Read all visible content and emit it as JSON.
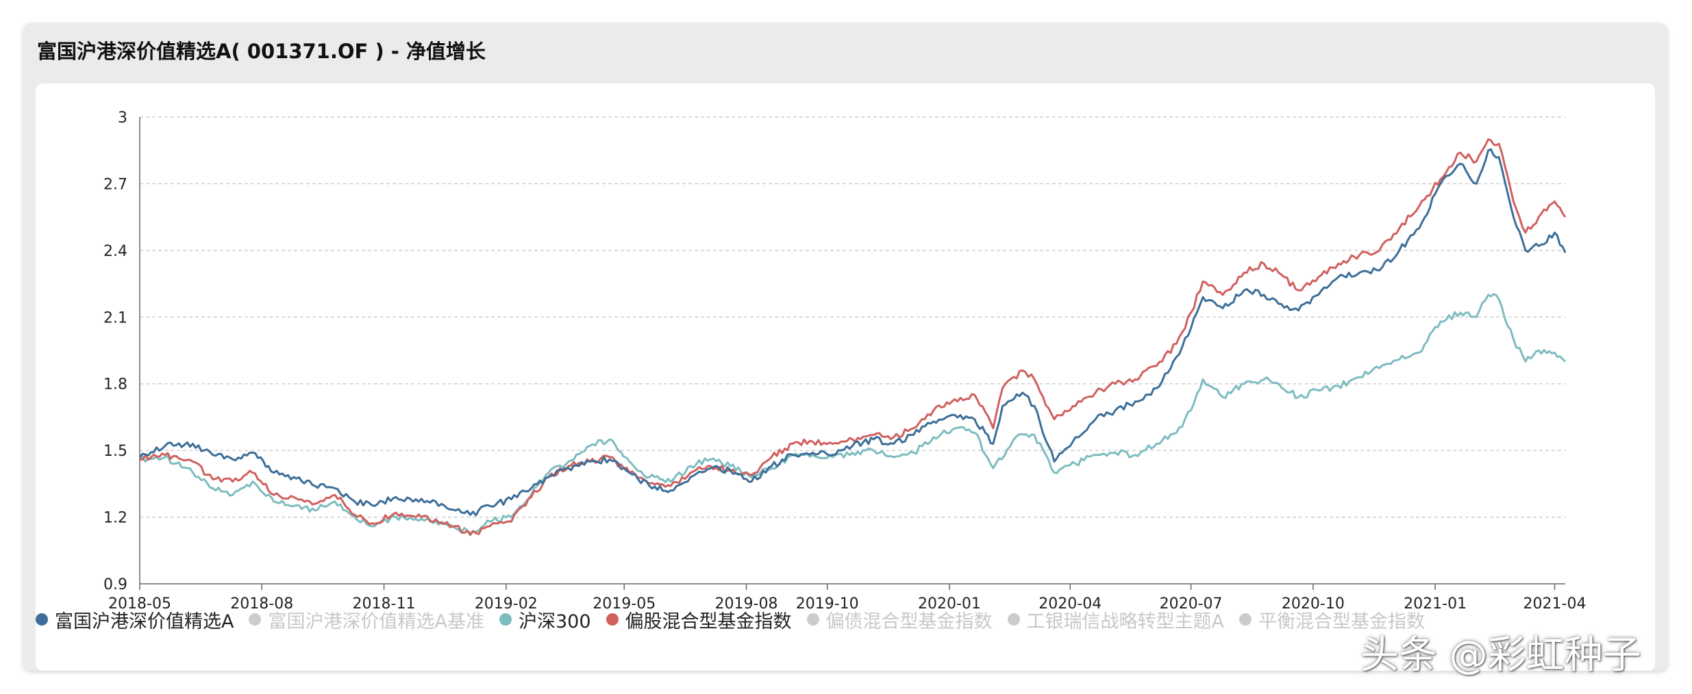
{
  "window": {
    "title": "富国沪港深价值精选A( 001371.OF ) - 净值增长"
  },
  "chart_data": {
    "type": "line",
    "title": "",
    "xlabel": "",
    "ylabel": "",
    "ylim": [
      0.9,
      3.0
    ],
    "yticks": [
      0.9,
      1.2,
      1.5,
      1.8,
      2.1,
      2.4,
      2.7,
      3
    ],
    "yticklabels": [
      "0.9",
      "1.2",
      "1.5",
      "1.8",
      "2.1",
      "2.4",
      "2.7",
      "3"
    ],
    "xlim": [
      "2018-05-01",
      "2021-04-09"
    ],
    "xticks": [
      "2018-05-01",
      "2018-08-01",
      "2018-11-01",
      "2019-02-01",
      "2019-05-01",
      "2019-08-01",
      "2019-10-01",
      "2020-01-01",
      "2020-04-01",
      "2020-07-01",
      "2020-10-01",
      "2021-01-01",
      "2021-04-01"
    ],
    "xticklabels": [
      "2018-05",
      "2018-08",
      "2018-11",
      "2019-02",
      "2019-05",
      "2019-08",
      "2019-10",
      "2020-01",
      "2020-04",
      "2020-07",
      "2020-10",
      "2021-01",
      "2021-04"
    ],
    "grid": true,
    "legend_position": "bottom",
    "series": [
      {
        "name": "沪深300",
        "color": "#7dbcbf",
        "visible": true,
        "points": [
          [
            "2018-05-01",
            1.46
          ],
          [
            "2018-05-20",
            1.47
          ],
          [
            "2018-06-10",
            1.4
          ],
          [
            "2018-06-25",
            1.33
          ],
          [
            "2018-07-10",
            1.3
          ],
          [
            "2018-07-25",
            1.36
          ],
          [
            "2018-08-10",
            1.27
          ],
          [
            "2018-08-25",
            1.25
          ],
          [
            "2018-09-10",
            1.23
          ],
          [
            "2018-09-25",
            1.27
          ],
          [
            "2018-10-10",
            1.2
          ],
          [
            "2018-10-25",
            1.16
          ],
          [
            "2018-11-10",
            1.2
          ],
          [
            "2018-11-25",
            1.19
          ],
          [
            "2018-12-10",
            1.18
          ],
          [
            "2018-12-25",
            1.15
          ],
          [
            "2019-01-05",
            1.13
          ],
          [
            "2019-01-20",
            1.18
          ],
          [
            "2019-02-05",
            1.2
          ],
          [
            "2019-02-20",
            1.3
          ],
          [
            "2019-03-05",
            1.4
          ],
          [
            "2019-03-20",
            1.45
          ],
          [
            "2019-04-05",
            1.52
          ],
          [
            "2019-04-20",
            1.55
          ],
          [
            "2019-05-05",
            1.45
          ],
          [
            "2019-05-20",
            1.38
          ],
          [
            "2019-06-05",
            1.36
          ],
          [
            "2019-06-20",
            1.43
          ],
          [
            "2019-07-05",
            1.46
          ],
          [
            "2019-07-20",
            1.43
          ],
          [
            "2019-08-05",
            1.38
          ],
          [
            "2019-08-20",
            1.42
          ],
          [
            "2019-09-05",
            1.48
          ],
          [
            "2019-09-20",
            1.48
          ],
          [
            "2019-10-05",
            1.47
          ],
          [
            "2019-10-20",
            1.49
          ],
          [
            "2019-11-05",
            1.5
          ],
          [
            "2019-11-20",
            1.47
          ],
          [
            "2019-12-05",
            1.49
          ],
          [
            "2019-12-20",
            1.56
          ],
          [
            "2020-01-05",
            1.6
          ],
          [
            "2020-01-20",
            1.58
          ],
          [
            "2020-02-03",
            1.42
          ],
          [
            "2020-02-20",
            1.56
          ],
          [
            "2020-03-05",
            1.57
          ],
          [
            "2020-03-20",
            1.4
          ],
          [
            "2020-04-05",
            1.44
          ],
          [
            "2020-04-20",
            1.48
          ],
          [
            "2020-05-05",
            1.49
          ],
          [
            "2020-05-20",
            1.48
          ],
          [
            "2020-06-05",
            1.53
          ],
          [
            "2020-06-20",
            1.58
          ],
          [
            "2020-07-01",
            1.68
          ],
          [
            "2020-07-10",
            1.82
          ],
          [
            "2020-07-25",
            1.74
          ],
          [
            "2020-08-10",
            1.8
          ],
          [
            "2020-08-25",
            1.82
          ],
          [
            "2020-09-05",
            1.8
          ],
          [
            "2020-09-20",
            1.74
          ],
          [
            "2020-10-05",
            1.77
          ],
          [
            "2020-10-20",
            1.79
          ],
          [
            "2020-11-05",
            1.83
          ],
          [
            "2020-11-20",
            1.87
          ],
          [
            "2020-12-05",
            1.91
          ],
          [
            "2020-12-20",
            1.94
          ],
          [
            "2021-01-05",
            2.08
          ],
          [
            "2021-01-20",
            2.12
          ],
          [
            "2021-02-01",
            2.1
          ],
          [
            "2021-02-10",
            2.2
          ],
          [
            "2021-02-18",
            2.18
          ],
          [
            "2021-03-01",
            2.0
          ],
          [
            "2021-03-10",
            1.9
          ],
          [
            "2021-03-20",
            1.95
          ],
          [
            "2021-04-01",
            1.94
          ],
          [
            "2021-04-09",
            1.9
          ]
        ]
      },
      {
        "name": "偏股混合型基金指数",
        "color": "#d0605e",
        "visible": true,
        "points": [
          [
            "2018-05-01",
            1.46
          ],
          [
            "2018-05-20",
            1.48
          ],
          [
            "2018-06-10",
            1.45
          ],
          [
            "2018-06-25",
            1.37
          ],
          [
            "2018-07-10",
            1.36
          ],
          [
            "2018-07-25",
            1.4
          ],
          [
            "2018-08-10",
            1.3
          ],
          [
            "2018-08-25",
            1.29
          ],
          [
            "2018-09-10",
            1.26
          ],
          [
            "2018-09-25",
            1.3
          ],
          [
            "2018-10-10",
            1.21
          ],
          [
            "2018-10-25",
            1.17
          ],
          [
            "2018-11-10",
            1.22
          ],
          [
            "2018-11-25",
            1.2
          ],
          [
            "2018-12-10",
            1.19
          ],
          [
            "2018-12-25",
            1.16
          ],
          [
            "2019-01-05",
            1.12
          ],
          [
            "2019-01-20",
            1.16
          ],
          [
            "2019-02-05",
            1.18
          ],
          [
            "2019-02-20",
            1.29
          ],
          [
            "2019-03-05",
            1.38
          ],
          [
            "2019-03-20",
            1.43
          ],
          [
            "2019-04-05",
            1.45
          ],
          [
            "2019-04-20",
            1.47
          ],
          [
            "2019-05-05",
            1.4
          ],
          [
            "2019-05-20",
            1.35
          ],
          [
            "2019-06-05",
            1.34
          ],
          [
            "2019-06-20",
            1.4
          ],
          [
            "2019-07-05",
            1.43
          ],
          [
            "2019-07-20",
            1.41
          ],
          [
            "2019-08-05",
            1.39
          ],
          [
            "2019-08-20",
            1.47
          ],
          [
            "2019-09-05",
            1.53
          ],
          [
            "2019-09-20",
            1.54
          ],
          [
            "2019-10-05",
            1.53
          ],
          [
            "2019-10-20",
            1.55
          ],
          [
            "2019-11-05",
            1.57
          ],
          [
            "2019-11-20",
            1.56
          ],
          [
            "2019-12-05",
            1.6
          ],
          [
            "2019-12-20",
            1.68
          ],
          [
            "2020-01-05",
            1.73
          ],
          [
            "2020-01-20",
            1.75
          ],
          [
            "2020-02-03",
            1.6
          ],
          [
            "2020-02-10",
            1.78
          ],
          [
            "2020-02-25",
            1.86
          ],
          [
            "2020-03-05",
            1.82
          ],
          [
            "2020-03-20",
            1.64
          ],
          [
            "2020-04-05",
            1.7
          ],
          [
            "2020-04-20",
            1.76
          ],
          [
            "2020-05-05",
            1.8
          ],
          [
            "2020-05-20",
            1.82
          ],
          [
            "2020-06-05",
            1.88
          ],
          [
            "2020-06-20",
            1.98
          ],
          [
            "2020-07-01",
            2.12
          ],
          [
            "2020-07-10",
            2.26
          ],
          [
            "2020-07-25",
            2.2
          ],
          [
            "2020-08-10",
            2.3
          ],
          [
            "2020-08-25",
            2.34
          ],
          [
            "2020-09-05",
            2.3
          ],
          [
            "2020-09-20",
            2.22
          ],
          [
            "2020-10-05",
            2.28
          ],
          [
            "2020-10-20",
            2.34
          ],
          [
            "2020-11-05",
            2.38
          ],
          [
            "2020-11-20",
            2.4
          ],
          [
            "2020-12-05",
            2.5
          ],
          [
            "2020-12-20",
            2.6
          ],
          [
            "2021-01-05",
            2.72
          ],
          [
            "2021-01-20",
            2.84
          ],
          [
            "2021-02-01",
            2.8
          ],
          [
            "2021-02-10",
            2.9
          ],
          [
            "2021-02-18",
            2.88
          ],
          [
            "2021-03-01",
            2.62
          ],
          [
            "2021-03-10",
            2.48
          ],
          [
            "2021-03-20",
            2.55
          ],
          [
            "2021-04-01",
            2.62
          ],
          [
            "2021-04-09",
            2.55
          ]
        ]
      },
      {
        "name": "富国沪港深价值精选A",
        "color": "#3c6e98",
        "visible": true,
        "points": [
          [
            "2018-05-01",
            1.47
          ],
          [
            "2018-05-20",
            1.52
          ],
          [
            "2018-06-10",
            1.53
          ],
          [
            "2018-06-25",
            1.48
          ],
          [
            "2018-07-10",
            1.46
          ],
          [
            "2018-07-25",
            1.49
          ],
          [
            "2018-08-10",
            1.4
          ],
          [
            "2018-08-25",
            1.38
          ],
          [
            "2018-09-10",
            1.34
          ],
          [
            "2018-09-25",
            1.33
          ],
          [
            "2018-10-10",
            1.27
          ],
          [
            "2018-10-25",
            1.25
          ],
          [
            "2018-11-10",
            1.29
          ],
          [
            "2018-11-25",
            1.28
          ],
          [
            "2018-12-10",
            1.27
          ],
          [
            "2018-12-25",
            1.23
          ],
          [
            "2019-01-05",
            1.21
          ],
          [
            "2019-01-20",
            1.25
          ],
          [
            "2019-02-05",
            1.28
          ],
          [
            "2019-02-20",
            1.33
          ],
          [
            "2019-03-05",
            1.38
          ],
          [
            "2019-03-20",
            1.42
          ],
          [
            "2019-04-05",
            1.45
          ],
          [
            "2019-04-20",
            1.46
          ],
          [
            "2019-05-05",
            1.4
          ],
          [
            "2019-05-20",
            1.34
          ],
          [
            "2019-06-05",
            1.32
          ],
          [
            "2019-06-20",
            1.38
          ],
          [
            "2019-07-05",
            1.42
          ],
          [
            "2019-07-20",
            1.41
          ],
          [
            "2019-08-05",
            1.36
          ],
          [
            "2019-08-20",
            1.43
          ],
          [
            "2019-09-05",
            1.48
          ],
          [
            "2019-09-20",
            1.49
          ],
          [
            "2019-10-05",
            1.48
          ],
          [
            "2019-10-20",
            1.52
          ],
          [
            "2019-11-05",
            1.55
          ],
          [
            "2019-11-20",
            1.53
          ],
          [
            "2019-12-05",
            1.57
          ],
          [
            "2019-12-20",
            1.63
          ],
          [
            "2020-01-05",
            1.66
          ],
          [
            "2020-01-20",
            1.64
          ],
          [
            "2020-02-03",
            1.53
          ],
          [
            "2020-02-10",
            1.7
          ],
          [
            "2020-02-25",
            1.76
          ],
          [
            "2020-03-05",
            1.7
          ],
          [
            "2020-03-20",
            1.45
          ],
          [
            "2020-04-05",
            1.56
          ],
          [
            "2020-04-20",
            1.64
          ],
          [
            "2020-05-05",
            1.68
          ],
          [
            "2020-05-20",
            1.72
          ],
          [
            "2020-06-05",
            1.78
          ],
          [
            "2020-06-20",
            1.92
          ],
          [
            "2020-07-01",
            2.05
          ],
          [
            "2020-07-10",
            2.19
          ],
          [
            "2020-07-25",
            2.14
          ],
          [
            "2020-08-10",
            2.22
          ],
          [
            "2020-08-25",
            2.2
          ],
          [
            "2020-09-05",
            2.16
          ],
          [
            "2020-09-20",
            2.13
          ],
          [
            "2020-10-05",
            2.2
          ],
          [
            "2020-10-20",
            2.28
          ],
          [
            "2020-11-05",
            2.3
          ],
          [
            "2020-11-20",
            2.31
          ],
          [
            "2020-12-05",
            2.4
          ],
          [
            "2020-12-20",
            2.5
          ],
          [
            "2021-01-05",
            2.7
          ],
          [
            "2021-01-20",
            2.79
          ],
          [
            "2021-02-01",
            2.7
          ],
          [
            "2021-02-10",
            2.85
          ],
          [
            "2021-02-18",
            2.82
          ],
          [
            "2021-03-01",
            2.55
          ],
          [
            "2021-03-10",
            2.4
          ],
          [
            "2021-03-20",
            2.42
          ],
          [
            "2021-04-01",
            2.48
          ],
          [
            "2021-04-09",
            2.39
          ]
        ]
      }
    ]
  },
  "legend": {
    "items": [
      {
        "name": "富国沪港深价值精选A",
        "color": "#3c6e98",
        "active": true
      },
      {
        "name": "富国沪港深价值精选A基准",
        "color": "#cccccc",
        "active": false
      },
      {
        "name": "沪深300",
        "color": "#7dbcbf",
        "active": true
      },
      {
        "name": "偏股混合型基金指数",
        "color": "#d0605e",
        "active": true
      },
      {
        "name": "偏债混合型基金指数",
        "color": "#cccccc",
        "active": false
      },
      {
        "name": "工银瑞信战略转型主题A",
        "color": "#cccccc",
        "active": false
      },
      {
        "name": "平衡混合型基金指数",
        "color": "#cccccc",
        "active": false
      }
    ]
  },
  "watermark": {
    "text": "头条 @彩虹种子"
  },
  "colors": {
    "grid": "#cfcfcf",
    "axis": "#666666",
    "inactive_text": "#c8c8c8",
    "active_text": "#222222"
  }
}
